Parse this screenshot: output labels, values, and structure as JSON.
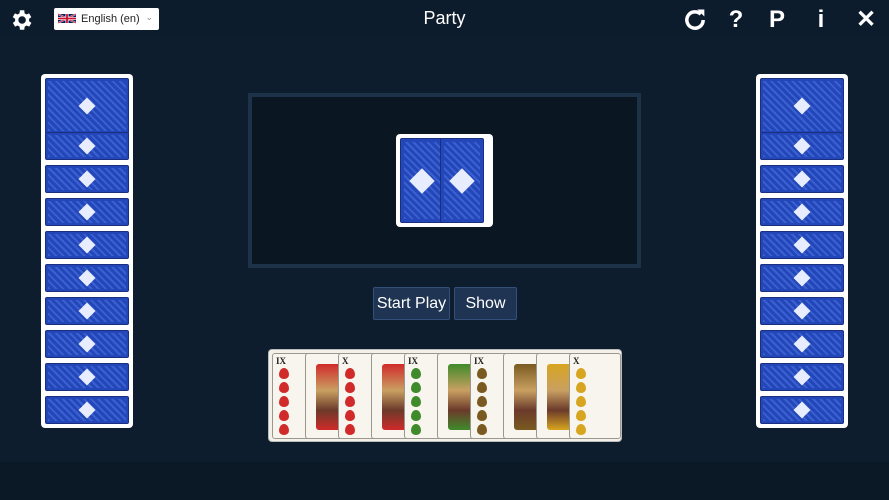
{
  "header": {
    "title": "Party",
    "language": "English (en)"
  },
  "toolbar": {
    "settings_icon": "gear-icon",
    "restart_icon": "restart-icon",
    "help_label": "?",
    "points_label": "P",
    "info_label": "i",
    "close_label": "✕"
  },
  "buttons": {
    "start_play": "Start Play",
    "show": "Show"
  },
  "opponents": {
    "left_card_count": 10,
    "right_card_count": 10
  },
  "talon": {
    "card_count": 2
  },
  "hand": {
    "cards": [
      {
        "rank": "IX",
        "suit": "hearts"
      },
      {
        "rank": "",
        "suit": "hearts"
      },
      {
        "rank": "X",
        "suit": "hearts"
      },
      {
        "rank": "",
        "suit": "hearts"
      },
      {
        "rank": "IX",
        "suit": "leaves"
      },
      {
        "rank": "",
        "suit": "leaves"
      },
      {
        "rank": "IX",
        "suit": "acorns"
      },
      {
        "rank": "",
        "suit": "acorns"
      },
      {
        "rank": "",
        "suit": "bells"
      },
      {
        "rank": "X",
        "suit": "bells"
      }
    ]
  },
  "colors": {
    "background": "#0e1d2d",
    "card_back": "#2346b8",
    "button": "#1e3452"
  }
}
